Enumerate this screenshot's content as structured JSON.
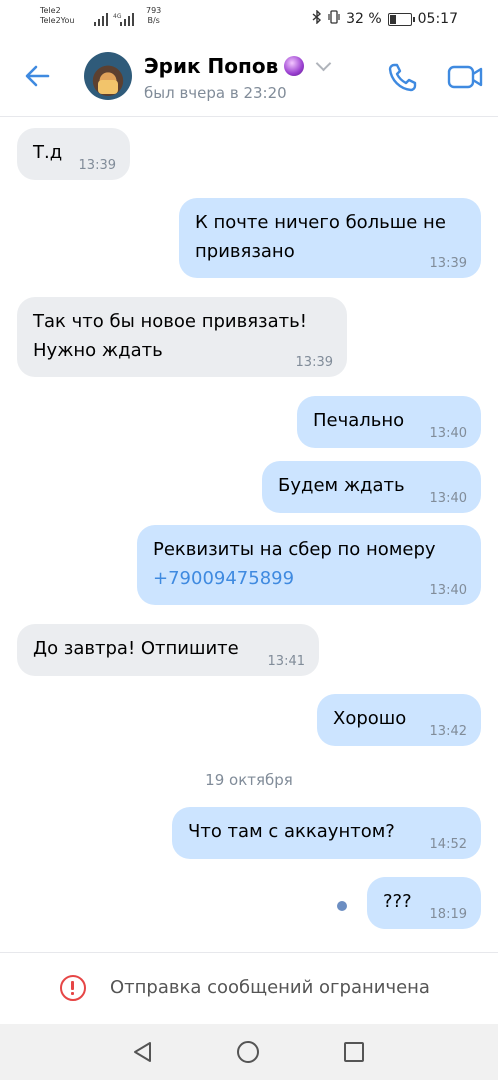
{
  "status_bar": {
    "carrier1": "Tele2",
    "carrier2": "Tele2You",
    "network": "4G",
    "speed_value": "793",
    "speed_unit": "B/s",
    "battery": "32 %",
    "time": "05:17"
  },
  "header": {
    "name": "Эрик Попов",
    "last_seen": "был вчера в 23:20"
  },
  "messages": [
    {
      "text": "Т.д",
      "time": "13:39"
    },
    {
      "line1": "К почте ничего больше не",
      "line2": "привязано",
      "time": "13:39"
    },
    {
      "line1": "Так что бы новое привязать!",
      "line2": "Нужно ждать",
      "time": "13:39"
    },
    {
      "text": "Печально",
      "time": "13:40"
    },
    {
      "text": "Будем ждать",
      "time": "13:40"
    },
    {
      "line1": "Реквизиты на сбер по номеру",
      "link": "+79009475899",
      "time": "13:40"
    },
    {
      "text": "До завтра! Отпишите",
      "time": "13:41"
    },
    {
      "text": "Хорошо",
      "time": "13:42"
    },
    {
      "text": "Что там с аккаунтом?",
      "time": "14:52"
    },
    {
      "text": "???",
      "time": "18:19"
    }
  ],
  "date_separator": "19 октября",
  "restricted_notice": "Отправка сообщений ограничена",
  "colors": {
    "accent": "#3f8ae0",
    "incoming_bubble": "#ebedf0",
    "outgoing_bubble": "#cce4ff",
    "warning": "#e64646"
  },
  "icons": {
    "back": "arrow-left-icon",
    "call": "phone-icon",
    "video": "video-camera-icon",
    "warning": "exclamation-circle-icon"
  }
}
